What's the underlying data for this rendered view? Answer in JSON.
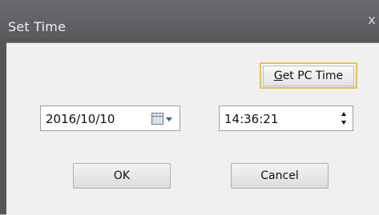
{
  "window": {
    "title": "Set Time",
    "close_glyph": "x"
  },
  "buttons": {
    "get_pc_time_prefix": "G",
    "get_pc_time_rest": "et PC Time",
    "ok": "OK",
    "cancel": "Cancel"
  },
  "date_picker": {
    "value": "2016/10/10",
    "icon": "calendar-icon"
  },
  "time_picker": {
    "value": "14:36:21",
    "icon": "spin-buttons"
  },
  "colors": {
    "frame": "#555658",
    "client_background": "#f0f0f0",
    "focus_border": "#e2c15a",
    "dropdown_arrow": "#2a64b5"
  }
}
